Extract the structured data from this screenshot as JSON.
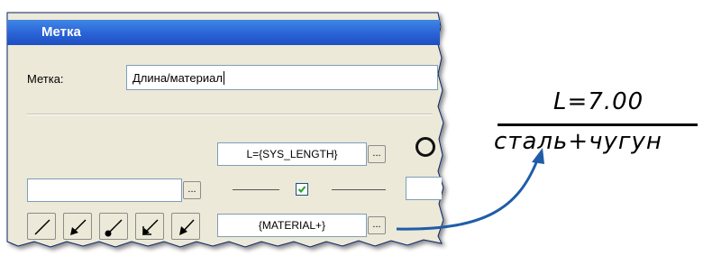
{
  "dialog": {
    "title": "Метка",
    "label_field": {
      "label": "Метка:",
      "value": "Длина/материал"
    },
    "top_format": {
      "value": "L={SYS_LENGTH}",
      "button_label": "..."
    },
    "left_input": {
      "value": "",
      "button_label": "..."
    },
    "divider_checkbox": {
      "checked": true
    },
    "bottom_format": {
      "value": "{MATERIAL+}",
      "button_label": "..."
    },
    "arrow_buttons": [
      {
        "icon": "line-icon"
      },
      {
        "icon": "arrow-icon"
      },
      {
        "icon": "dot-arrow-icon"
      },
      {
        "icon": "double-arrow-icon"
      },
      {
        "icon": "open-arrow-icon"
      }
    ]
  },
  "preview": {
    "numerator": "L=7.00",
    "denominator": "сталь+чугун"
  },
  "colors": {
    "titlebar": "#2a63d6",
    "dialog_bg": "#ece9d8",
    "accent_arrow": "#1f5da8",
    "field_border": "#7f9db9"
  }
}
